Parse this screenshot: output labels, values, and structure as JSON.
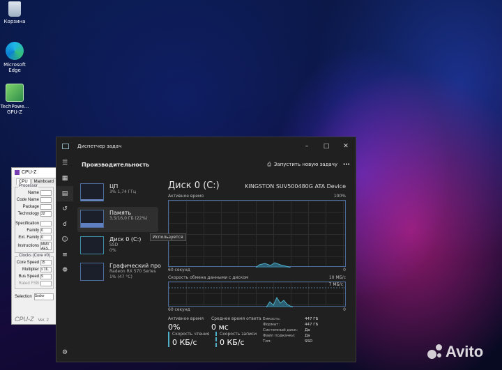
{
  "desktop": {
    "icons": [
      {
        "label": "Корзина"
      },
      {
        "label": "Microsoft Edge"
      },
      {
        "label": "TechPowe... GPU-Z"
      }
    ]
  },
  "cpuz": {
    "title": "CPU-Z",
    "tabs": [
      "CPU",
      "Mainboard"
    ],
    "processor_group": "Processor",
    "fields": [
      {
        "label": "Name",
        "value": ""
      },
      {
        "label": "Code Name",
        "value": ""
      },
      {
        "label": "Package",
        "value": ""
      },
      {
        "label": "Technology",
        "value": "22"
      },
      {
        "label": "Specification",
        "value": ""
      },
      {
        "label": "Family",
        "value": "6"
      },
      {
        "label": "Ext. Family",
        "value": "6"
      },
      {
        "label": "Instructions",
        "value": "MMX AES,"
      }
    ],
    "clocks_group": "Clocks (Core #0)",
    "clocks": [
      {
        "label": "Core Speed",
        "value": "15"
      },
      {
        "label": "Multiplier",
        "value": "x 16."
      },
      {
        "label": "Bus Speed",
        "value": "9"
      },
      {
        "label": "Rated FSB",
        "value": ""
      }
    ],
    "selection_label": "Selection",
    "selection_value": "Socke",
    "footer_logo": "CPU-Z",
    "footer_ver": "Ver. 2"
  },
  "tm": {
    "title": "Диспетчер задач",
    "header": "Производительность",
    "run_task": "Запустить новую задачу",
    "items": [
      {
        "name": "ЦП",
        "sub": "3% 1,74 ГГц"
      },
      {
        "name": "Память",
        "sub": "3,5/16,0 ГБ (22%)"
      },
      {
        "name": "Диск 0 (C:)",
        "sub": "SSD",
        "sub2": "0%"
      },
      {
        "name": "Графический про",
        "sub": "Radeon RX 570 Series",
        "sub2": "1% (47 °C)"
      }
    ],
    "tooltip": "Используется",
    "detail": {
      "title": "Диск 0 (C:)",
      "device": "KINGSTON SUV500480G ATA Device",
      "graph1_label": "Активное время",
      "graph1_max": "100%",
      "graph1_time": "60 секунд",
      "graph1_min": "0",
      "graph2_label": "Скорость обмена данными с диском",
      "graph2_max": "10 МБ/с",
      "graph2_mark": "7 МБ/с",
      "graph2_time": "60 секунд",
      "graph2_min": "0",
      "active_label": "Активное время",
      "active_value": "0%",
      "resp_label": "Среднее время ответа",
      "resp_value": "0 мс",
      "read_label": "Скорость чтения",
      "read_value": "0 КБ/с",
      "write_label": "Скорость записи",
      "write_value": "0 КБ/с",
      "props": [
        {
          "k": "Емкость:",
          "v": "447 ГБ"
        },
        {
          "k": "Формат:",
          "v": "447 ГБ"
        },
        {
          "k": "Системный диск:",
          "v": "Да"
        },
        {
          "k": "Файл подкачки:",
          "v": "Да"
        },
        {
          "k": "Тип:",
          "v": "SSD"
        }
      ]
    }
  },
  "watermark": "Avito",
  "colors": {
    "accent": "#4c6a9a",
    "graph_fill": "#2e6f86",
    "cpu_spark": "#6b8cc7"
  }
}
